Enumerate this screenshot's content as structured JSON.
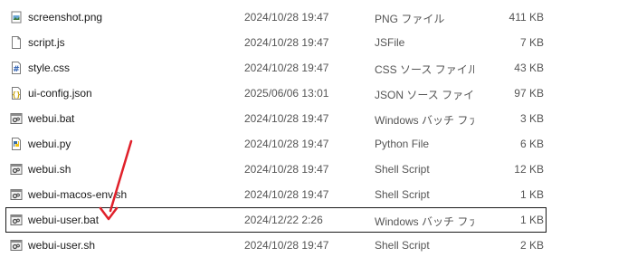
{
  "colors": {
    "annotation_arrow": "#e0202a",
    "focus_border": "#1a1a1a",
    "meta_text": "#555555"
  },
  "files": [
    {
      "name": "screenshot.png",
      "date": "2024/10/28 19:47",
      "type": "PNG ファイル",
      "size": "411 KB",
      "icon": "image-file-icon"
    },
    {
      "name": "script.js",
      "date": "2024/10/28 19:47",
      "type": "JSFile",
      "size": "7 KB",
      "icon": "blank-file-icon"
    },
    {
      "name": "style.css",
      "date": "2024/10/28 19:47",
      "type": "CSS ソース ファイル",
      "size": "43 KB",
      "icon": "css-file-icon"
    },
    {
      "name": "ui-config.json",
      "date": "2025/06/06 13:01",
      "type": "JSON ソース ファイル",
      "size": "97 KB",
      "icon": "json-file-icon"
    },
    {
      "name": "webui.bat",
      "date": "2024/10/28 19:47",
      "type": "Windows バッチ ファ...",
      "size": "3 KB",
      "icon": "batch-file-icon"
    },
    {
      "name": "webui.py",
      "date": "2024/10/28 19:47",
      "type": "Python File",
      "size": "6 KB",
      "icon": "python-file-icon"
    },
    {
      "name": "webui.sh",
      "date": "2024/10/28 19:47",
      "type": "Shell Script",
      "size": "12 KB",
      "icon": "shell-file-icon"
    },
    {
      "name": "webui-macos-env.sh",
      "date": "2024/10/28 19:47",
      "type": "Shell Script",
      "size": "1 KB",
      "icon": "shell-file-icon"
    },
    {
      "name": "webui-user.bat",
      "date": "2024/12/22 2:26",
      "type": "Windows バッチ ファ...",
      "size": "1 KB",
      "icon": "batch-file-icon",
      "focused": true
    },
    {
      "name": "webui-user.sh",
      "date": "2024/10/28 19:47",
      "type": "Shell Script",
      "size": "2 KB",
      "icon": "shell-file-icon"
    }
  ]
}
